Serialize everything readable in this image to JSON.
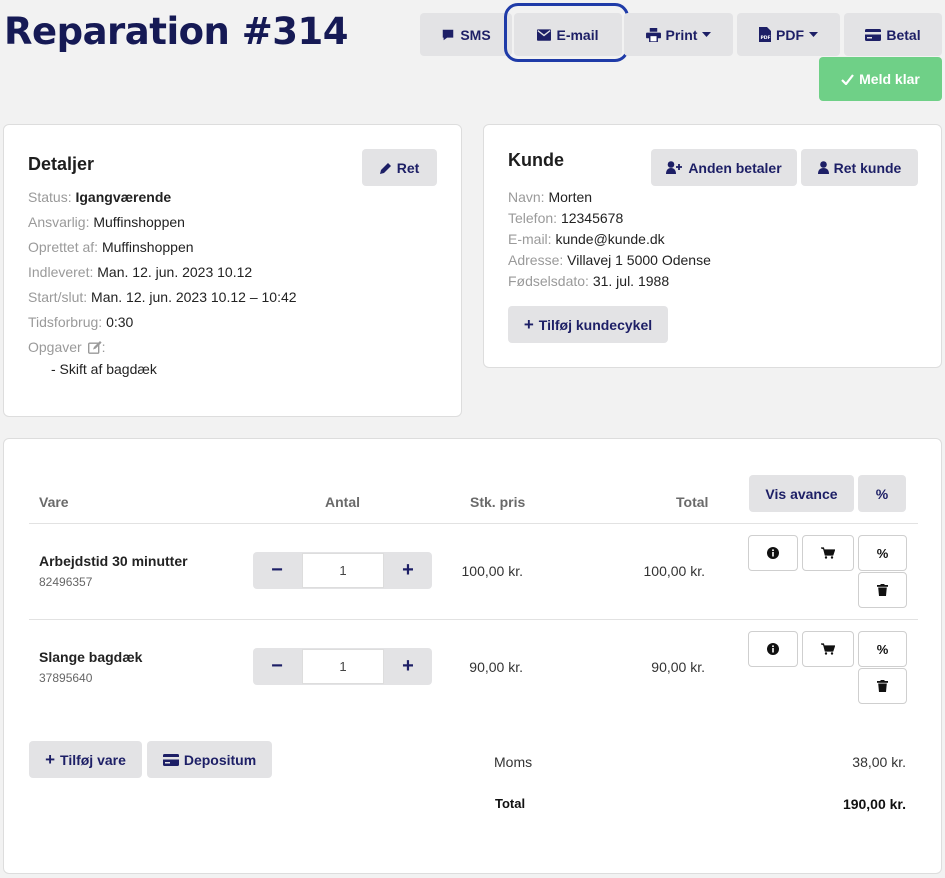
{
  "page": {
    "title": "Reparation #314"
  },
  "toolbar": {
    "sms": "SMS",
    "email": "E-mail",
    "print": "Print",
    "pdf": "PDF",
    "pay": "Betal",
    "ready": "Meld klar"
  },
  "details": {
    "title": "Detaljer",
    "edit": "Ret",
    "rows": [
      {
        "label": "Status:",
        "value": "Igangværende"
      },
      {
        "label": "Ansvarlig:",
        "value": "Muffinshoppen"
      },
      {
        "label": "Oprettet af:",
        "value": "Muffinshoppen"
      },
      {
        "label": "Indleveret:",
        "value": "Man. 12. jun. 2023 10.12"
      },
      {
        "label": "Start/slut:",
        "value": "Man. 12. jun. 2023 10.12 – 10:42"
      },
      {
        "label": "Tidsforbrug:",
        "value": "0:30"
      }
    ],
    "tasks_label": "Opgaver",
    "tasks_colon": ":",
    "tasks": [
      "-  Skift af bagdæk"
    ]
  },
  "customer": {
    "title": "Kunde",
    "other_payer": "Anden betaler",
    "edit_customer": "Ret kunde",
    "rows": [
      {
        "label": "Navn:",
        "value": "Morten"
      },
      {
        "label": "Telefon:",
        "value": "12345678"
      },
      {
        "label": "E-mail:",
        "value": "kunde@kunde.dk"
      },
      {
        "label": "Adresse:",
        "value": "Villavej 1 5000 Odense"
      },
      {
        "label": "Fødselsdato:",
        "value": "31. jul. 1988"
      }
    ],
    "add_bike": "Tilføj kundecykel"
  },
  "items": {
    "headers": {
      "item": "Vare",
      "qty": "Antal",
      "unit_price": "Stk. pris",
      "total": "Total"
    },
    "show_margin": "Vis avance",
    "percent": "%",
    "rows": [
      {
        "name": "Arbejdstid 30 minutter",
        "sku": "82496357",
        "qty": "1",
        "unit_price": "100,00 kr.",
        "total": "100,00 kr."
      },
      {
        "name": "Slange bagdæk",
        "sku": "37895640",
        "qty": "1",
        "unit_price": "90,00 kr.",
        "total": "90,00 kr."
      }
    ],
    "add_item": "Tilføj vare",
    "deposit": "Depositum",
    "vat_label": "Moms",
    "vat_value": "38,00 kr.",
    "total_label": "Total",
    "total_value": "190,00 kr.",
    "minus": "−",
    "plus": "+"
  },
  "colors": {
    "title": "#161a55",
    "button_text": "#1d1f66",
    "button_bg": "#e3e3e5",
    "ready_green": "#6fd087",
    "focus_ring": "#1f3ba8"
  }
}
